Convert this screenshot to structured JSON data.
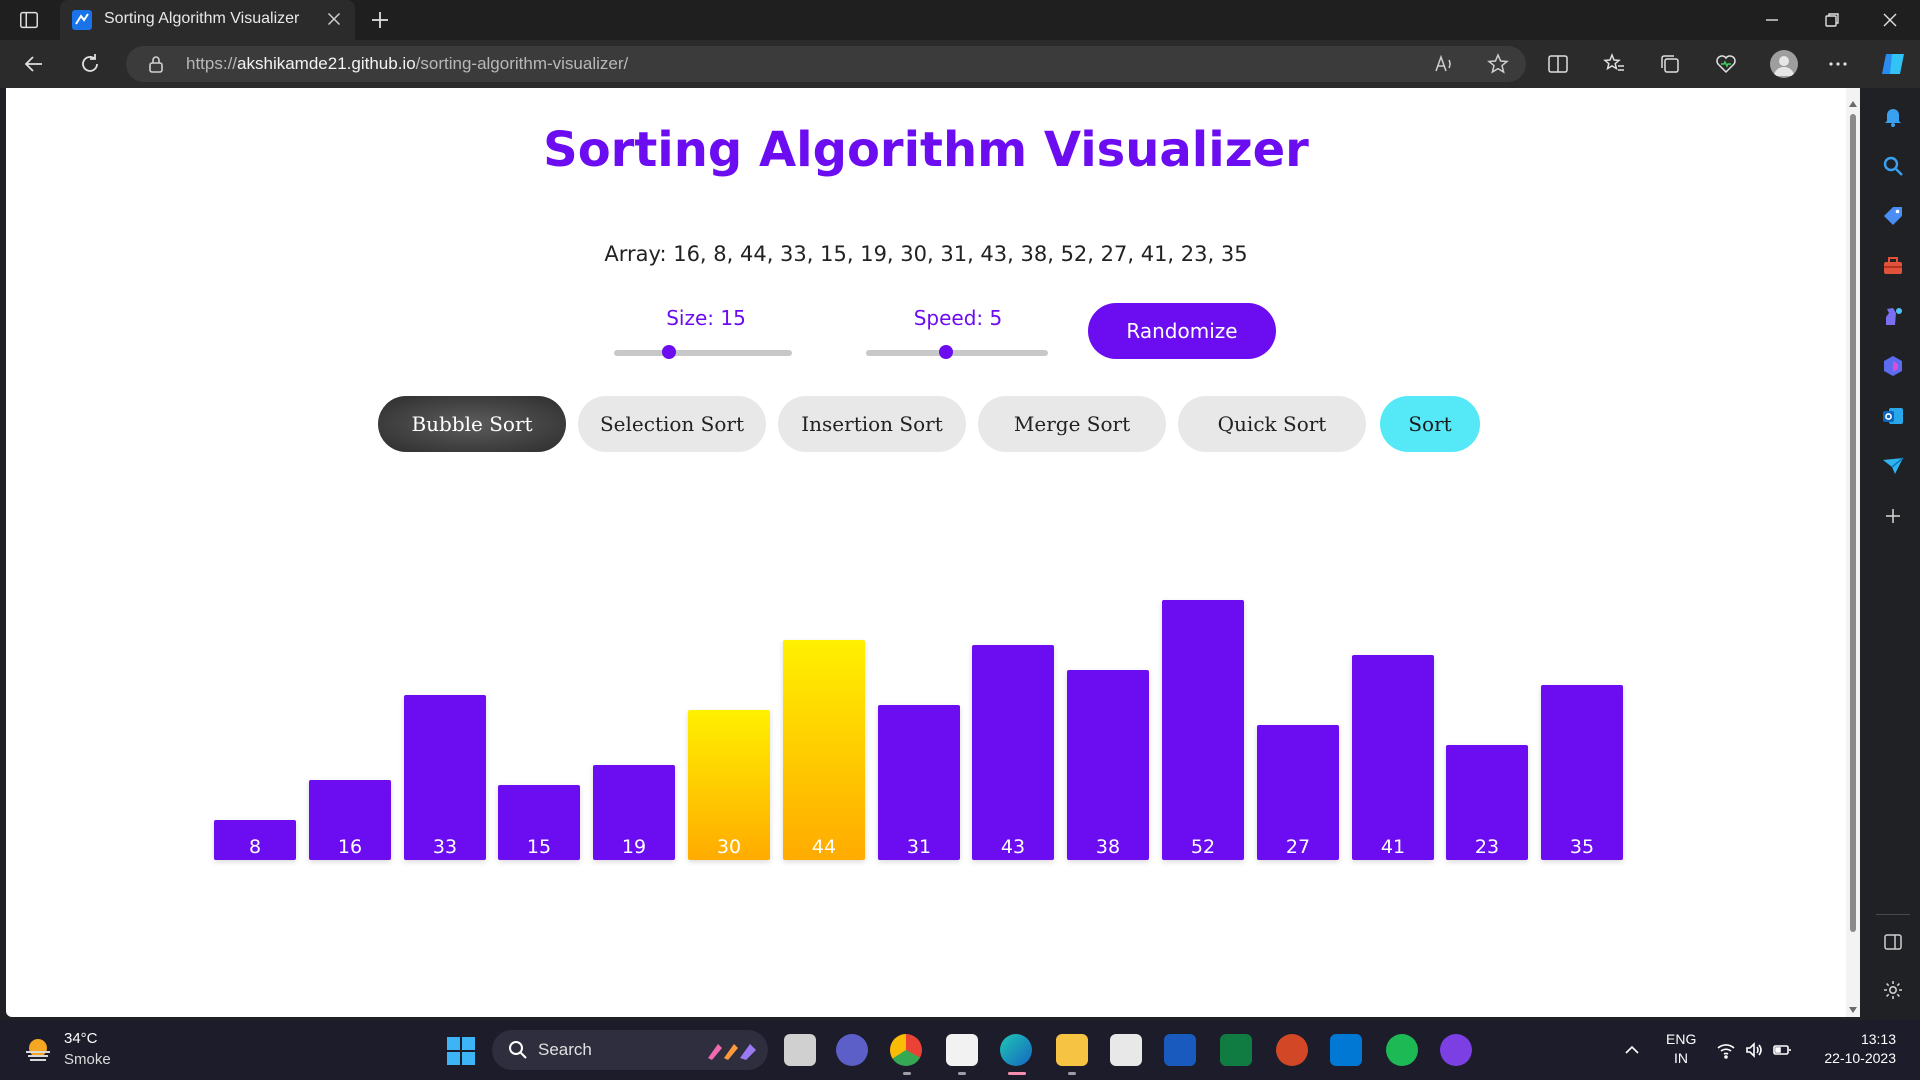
{
  "browser": {
    "tab_title": "Sorting Algorithm Visualizer",
    "url_prefix": "https://",
    "url_host": "akshikamde21.github.io",
    "url_path": "/sorting-algorithm-visualizer/"
  },
  "page": {
    "title": "Sorting Algorithm Visualizer",
    "array_text": "Array: 16, 8, 44, 33, 15, 19, 30, 31, 43, 38, 52, 27, 41, 23, 35",
    "size_label": "Size: 15",
    "speed_label": "Speed: 5",
    "size_value": 15,
    "speed_value": 5,
    "randomize_label": "Randomize",
    "algorithms": [
      "Bubble Sort",
      "Selection Sort",
      "Insertion Sort",
      "Merge Sort",
      "Quick Sort"
    ],
    "active_algorithm": "Bubble Sort",
    "sort_label": "Sort"
  },
  "chart_data": {
    "type": "bar",
    "values": [
      8,
      16,
      33,
      15,
      19,
      30,
      44,
      31,
      43,
      38,
      52,
      27,
      41,
      23,
      35
    ],
    "highlighted_indices": [
      5,
      6
    ],
    "bar_color": "#6c0cf0",
    "highlight_color": "#ffd000"
  },
  "taskbar": {
    "weather_temp": "34°C",
    "weather_cond": "Smoke",
    "search_label": "Search",
    "lang_line1": "ENG",
    "lang_line2": "IN",
    "time": "13:13",
    "date": "22-10-2023"
  },
  "colors": {
    "accent": "#6c0cf0",
    "sort_button": "#55e8f6"
  }
}
